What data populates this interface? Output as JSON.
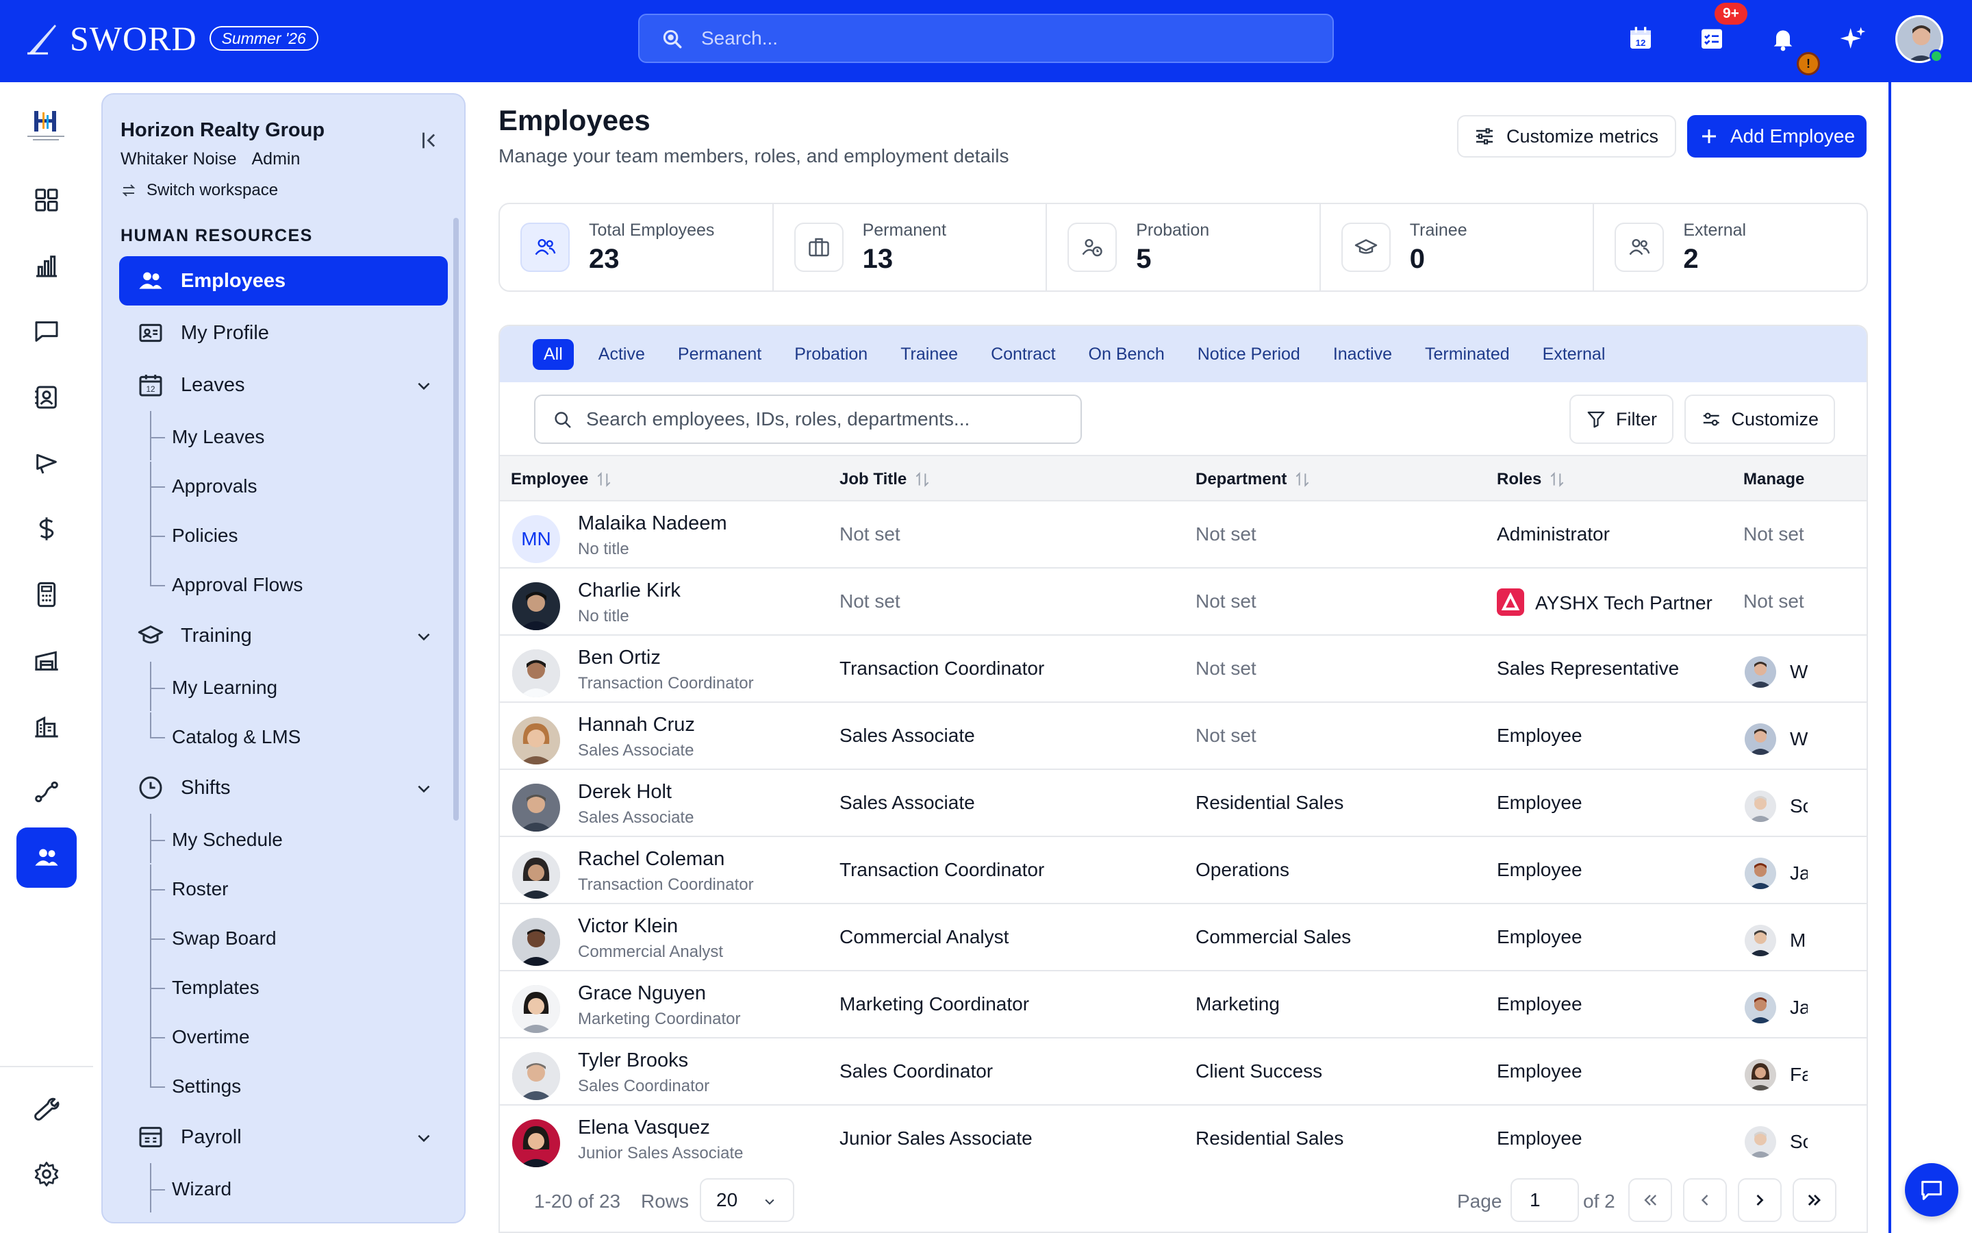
{
  "topbar": {
    "brand": "SWORD",
    "release": "Summer '26",
    "search_placeholder": "Search...",
    "tasks_badge": "9+",
    "alert_badge": "!",
    "accent": "#0a35f0"
  },
  "rail": {
    "items": [
      "dashboard-icon",
      "analytics-icon",
      "messages-icon",
      "contacts-icon",
      "campaigns-icon",
      "finance-icon",
      "calculator-icon",
      "warehouse-icon",
      "buildings-icon",
      "workflow-icon",
      "people-icon"
    ],
    "active": "people-icon",
    "bottom": [
      "tools-icon",
      "settings-icon"
    ]
  },
  "sidebar": {
    "org_name": "Horizon Realty Group",
    "user_name": "Whitaker Noise",
    "user_role": "Admin",
    "switch_label": "Switch workspace",
    "section_title": "HUMAN RESOURCES",
    "items": {
      "employees": "Employees",
      "my_profile": "My Profile",
      "leaves": "Leaves",
      "my_leaves": "My Leaves",
      "approvals": "Approvals",
      "policies": "Policies",
      "approval_flows": "Approval Flows",
      "training": "Training",
      "my_learning": "My Learning",
      "catalog": "Catalog & LMS",
      "shifts": "Shifts",
      "my_schedule": "My Schedule",
      "roster": "Roster",
      "swap_board": "Swap Board",
      "templates": "Templates",
      "overtime": "Overtime",
      "settings": "Settings",
      "payroll": "Payroll",
      "wizard": "Wizard"
    }
  },
  "header": {
    "title": "Employees",
    "subtitle": "Manage your team members, roles, and employment details",
    "customize_metrics": "Customize metrics",
    "add_employee": "Add Employee"
  },
  "stats": [
    {
      "label": "Total Employees",
      "value": "23",
      "icon": "people-icon"
    },
    {
      "label": "Permanent",
      "value": "13",
      "icon": "briefcase-icon"
    },
    {
      "label": "Probation",
      "value": "5",
      "icon": "user-clock-icon"
    },
    {
      "label": "Trainee",
      "value": "0",
      "icon": "graduation-cap-icon"
    },
    {
      "label": "External",
      "value": "2",
      "icon": "people-icon"
    }
  ],
  "tabs": [
    "All",
    "Active",
    "Permanent",
    "Probation",
    "Trainee",
    "Contract",
    "On Bench",
    "Notice Period",
    "Inactive",
    "Terminated",
    "External"
  ],
  "table": {
    "search_placeholder": "Search employees, IDs, roles, departments...",
    "filter_label": "Filter",
    "customize_label": "Customize",
    "columns": [
      "Employee",
      "Job Title",
      "Department",
      "Roles",
      "Manage"
    ],
    "rows": [
      {
        "name": "Malaika Nadeem",
        "subtitle": "No title",
        "initials": "MN",
        "job": "Not set",
        "dept": "Not set",
        "role": "Administrator",
        "manager": "Not set"
      },
      {
        "name": "Charlie Kirk",
        "subtitle": "No title",
        "job": "Not set",
        "dept": "Not set",
        "role": "AYSHX Tech Partner",
        "manager": "Not set"
      },
      {
        "name": "Ben Ortiz",
        "subtitle": "Transaction Coordinator",
        "job": "Transaction Coordinator",
        "dept": "Not set",
        "role": "Sales Representative",
        "manager": "W"
      },
      {
        "name": "Hannah Cruz",
        "subtitle": "Sales Associate",
        "job": "Sales Associate",
        "dept": "Not set",
        "role": "Employee",
        "manager": "W"
      },
      {
        "name": "Derek Holt",
        "subtitle": "Sales Associate",
        "job": "Sales Associate",
        "dept": "Residential Sales",
        "role": "Employee",
        "manager": "Sc"
      },
      {
        "name": "Rachel Coleman",
        "subtitle": "Transaction Coordinator",
        "job": "Transaction Coordinator",
        "dept": "Operations",
        "role": "Employee",
        "manager": "Ja"
      },
      {
        "name": "Victor Klein",
        "subtitle": "Commercial Analyst",
        "job": "Commercial Analyst",
        "dept": "Commercial Sales",
        "role": "Employee",
        "manager": "M"
      },
      {
        "name": "Grace Nguyen",
        "subtitle": "Marketing Coordinator",
        "job": "Marketing Coordinator",
        "dept": "Marketing",
        "role": "Employee",
        "manager": "Ja"
      },
      {
        "name": "Tyler Brooks",
        "subtitle": "Sales Coordinator",
        "job": "Sales Coordinator",
        "dept": "Client Success",
        "role": "Employee",
        "manager": "Fa"
      },
      {
        "name": "Elena Vasquez",
        "subtitle": "Junior Sales Associate",
        "job": "Junior Sales Associate",
        "dept": "Residential Sales",
        "role": "Employee",
        "manager": "Sc"
      }
    ]
  },
  "pagination": {
    "range": "1-20 of 23",
    "rows_label": "Rows",
    "rows_value": "20",
    "page_label": "Page",
    "page_value": "1",
    "of_label": "of 2"
  }
}
